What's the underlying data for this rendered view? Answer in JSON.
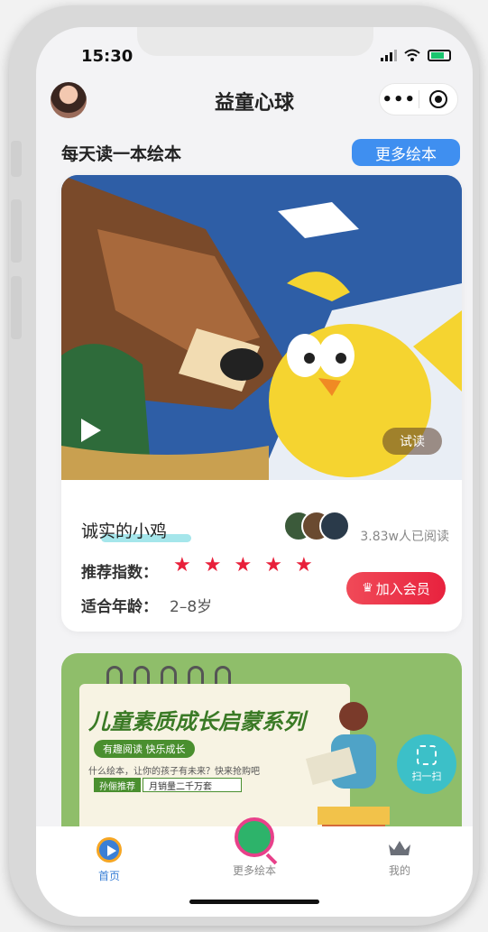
{
  "status_bar": {
    "time": "15:30"
  },
  "navbar": {
    "title": "益童心球",
    "more_glyph": "•••"
  },
  "section": {
    "title": "每天读一本绘本",
    "more_button": "更多绘本"
  },
  "book": {
    "trial_label": "试读",
    "name": "诚实的小鸡",
    "readers": "3.83w人已阅读",
    "rating_label": "推荐指数：",
    "rating": 5,
    "rating_max": 5,
    "age_label": "适合年龄：",
    "age_value": "2–8岁",
    "vip_button": "加入会员",
    "colors": {
      "star": "#e8203a",
      "vip": "#e8223e"
    }
  },
  "banner": {
    "title": "儿童素质成长启蒙系列",
    "subtitle": "有趣阅读  快乐成长",
    "line": "什么绘本，让你的孩子有未来？快来抢购吧",
    "tag1": "孙俪推荐",
    "tag2": "月销量二千万套",
    "scan_label": "扫一扫"
  },
  "tabbar": {
    "items": [
      {
        "label": "首页",
        "icon": "home-play-icon",
        "active": true
      },
      {
        "label": "更多绘本",
        "icon": "magnifier-icon",
        "active": false
      },
      {
        "label": "我的",
        "icon": "crown-icon",
        "active": false
      }
    ]
  },
  "colors": {
    "accent": "#3f8ff0",
    "banner_green": "#8fbe6a"
  }
}
